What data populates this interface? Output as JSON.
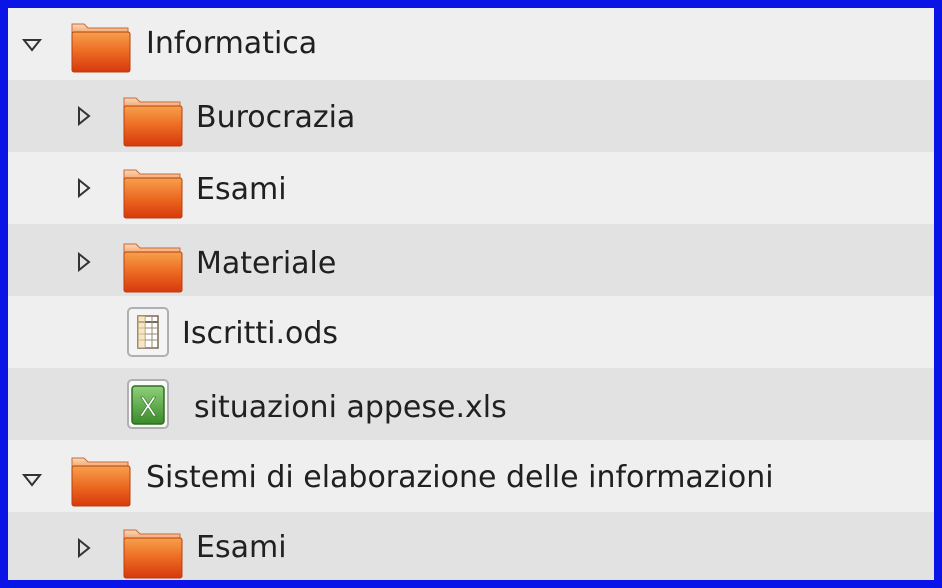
{
  "tree": {
    "rows": [
      {
        "label": "Informatica",
        "type": "folder",
        "expanded": true
      },
      {
        "label": "Burocrazia",
        "type": "folder",
        "expanded": false
      },
      {
        "label": "Esami",
        "type": "folder",
        "expanded": false
      },
      {
        "label": "Materiale",
        "type": "folder",
        "expanded": false
      },
      {
        "label": "Iscritti.ods",
        "type": "spreadsheet-ods"
      },
      {
        "label": "situazioni appese.xls",
        "type": "spreadsheet-xls"
      },
      {
        "label": "Sistemi di elaborazione delle informazioni",
        "type": "folder",
        "expanded": true
      },
      {
        "label": "Esami",
        "type": "folder",
        "expanded": false
      }
    ]
  },
  "icons": {
    "folder": "folder-icon",
    "ods": "ods-spreadsheet-icon",
    "xls": "xls-excel-icon",
    "expanded": "triangle-down-icon",
    "collapsed": "triangle-right-icon",
    "xls_glyph": "X"
  },
  "colors": {
    "frame_border": "#0a14e6",
    "folder_orange": "#e8541a",
    "xls_green": "#3a8a2a"
  }
}
